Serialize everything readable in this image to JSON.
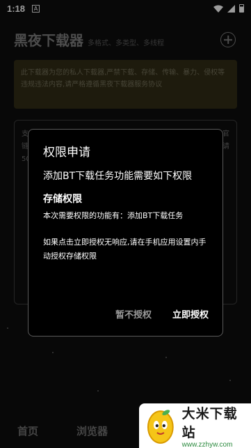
{
  "status_bar": {
    "time": "1:18",
    "notification_icon": "A",
    "icons": [
      "wifi-icon",
      "signal-icon",
      "battery-icon"
    ]
  },
  "header": {
    "title": "黑夜下载器",
    "subtitle": "多格式、多类型、多线程",
    "add_icon": "plus-circle-icon"
  },
  "notice": {
    "text": "此下载器为您的私人下载器,严禁下载、存储、传输、暴力、侵权等违规违法内容,请严格遵循黑夜下载器服务协议"
  },
  "card_fragments": {
    "left_1": "支",
    "left_2": "链",
    "left_3": "50",
    "right_1": "官",
    "right_2": "请"
  },
  "dialog": {
    "title": "权限申请",
    "message": "添加BT下载任务功能需要如下权限",
    "permission_title": "存储权限",
    "permission_desc": "本次需要权限的功能有：添加BT下载任务",
    "hint": "如果点击立即授权无响应,请在手机应用设置内手动授权存储权限",
    "deny_label": "暂不授权",
    "grant_label": "立即授权"
  },
  "bottom_nav": {
    "home_label": "首页",
    "browser_label": "浏览器"
  },
  "watermark": {
    "name": "大米下载站",
    "url": "www.zzhyw.com"
  },
  "colors": {
    "background": "#0d0d0d",
    "notice_bg": "#2e2a14",
    "dialog_bg": "#000000",
    "accent_green": "#2b8a3e"
  }
}
